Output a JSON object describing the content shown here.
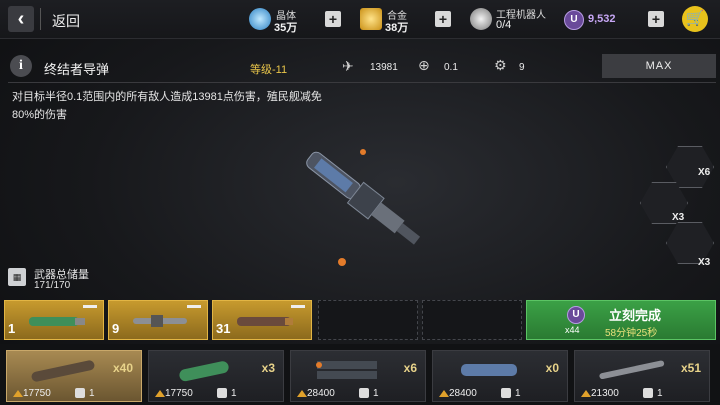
{
  "header": {
    "back_label": "返回",
    "crystal": {
      "name": "晶体",
      "value": "35万"
    },
    "alloy": {
      "name": "合金",
      "value": "38万"
    },
    "robots": {
      "name": "工程机器人",
      "value": "0/4"
    },
    "currency": {
      "symbol": "U",
      "value": "9,532"
    }
  },
  "weapon": {
    "name": "终结者导弹",
    "level": "等级-11",
    "damage": "13981",
    "radius": "0.1",
    "stat3": "9",
    "max_label": "MAX",
    "description": "对目标半径0.1范围内的所有敌人造成13981点伤害，殖民舰减免80%的伤害"
  },
  "storage": {
    "label": "武器总储量",
    "count": "171/170"
  },
  "queue": [
    {
      "count": "1"
    },
    {
      "count": "9"
    },
    {
      "count": "31"
    }
  ],
  "complete": {
    "label": "立刻完成",
    "time": "58分钟25秒",
    "cost": "x44",
    "symbol": "U"
  },
  "side": [
    {
      "qty": "X6"
    },
    {
      "qty": "X3"
    },
    {
      "qty": "X3"
    }
  ],
  "inventory": [
    {
      "qty": "x40",
      "cost": "17750",
      "bots": "1"
    },
    {
      "qty": "x3",
      "cost": "17750",
      "bots": "1"
    },
    {
      "qty": "x6",
      "cost": "28400",
      "bots": "1"
    },
    {
      "qty": "x0",
      "cost": "28400",
      "bots": "1"
    },
    {
      "qty": "x51",
      "cost": "21300",
      "bots": "1"
    }
  ],
  "colors": {
    "gold": "#c79a2e",
    "green": "#3ba146",
    "purple": "#6a4a9a",
    "level": "#e8c54a"
  }
}
